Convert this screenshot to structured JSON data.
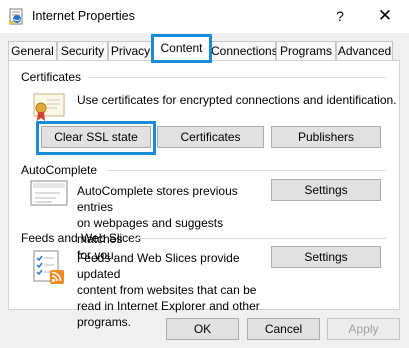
{
  "window": {
    "title": "Internet Properties",
    "help_glyph": "?",
    "close_glyph": "✕"
  },
  "tabs": [
    {
      "label": "General"
    },
    {
      "label": "Security"
    },
    {
      "label": "Privacy"
    },
    {
      "label": "Content"
    },
    {
      "label": "Connections"
    },
    {
      "label": "Programs"
    },
    {
      "label": "Advanced"
    }
  ],
  "active_tab": "Content",
  "certificates": {
    "group_title": "Certificates",
    "description": "Use certificates for encrypted connections and identification.",
    "buttons": {
      "clear_ssl": "Clear SSL state",
      "certificates": "Certificates",
      "publishers": "Publishers"
    }
  },
  "autocomplete": {
    "group_title": "AutoComplete",
    "description_lines": [
      "AutoComplete stores previous entries",
      "on webpages and suggests matches",
      "for you."
    ],
    "settings_label": "Settings"
  },
  "feeds": {
    "group_title": "Feeds and Web Slices",
    "description_lines": [
      "Feeds and Web Slices provide updated",
      "content from websites that can be",
      "read in Internet Explorer and other",
      "programs."
    ],
    "settings_label": "Settings"
  },
  "footer": {
    "ok_label": "OK",
    "cancel_label": "Cancel",
    "apply_label": "Apply",
    "apply_enabled": false
  },
  "colors": {
    "highlight": "#1b8bd6",
    "window_bg": "#f0f0f0"
  }
}
